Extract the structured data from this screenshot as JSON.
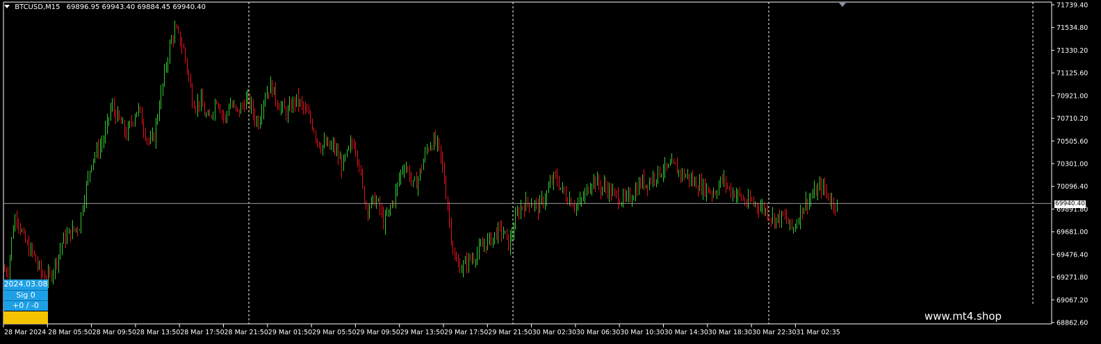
{
  "header": {
    "symbol": "BTCUSD,M15",
    "ohlc": "69896.95 69943.40 69884.45 69940.40"
  },
  "price_axis": {
    "labels": [
      "71739.40",
      "71534.80",
      "71330.20",
      "71125.60",
      "70921.00",
      "70710.20",
      "70505.60",
      "70301.00",
      "70096.40",
      "69891.80",
      "69681.00",
      "69476.40",
      "69271.80",
      "69067.20",
      "68862.60"
    ],
    "current_price": "69940.40"
  },
  "time_axis": {
    "labels": [
      "28 Mar 2024",
      "28 Mar 05:50",
      "28 Mar 09:50",
      "28 Mar 13:50",
      "28 Mar 17:50",
      "28 Mar 21:50",
      "29 Mar 01:50",
      "29 Mar 05:50",
      "29 Mar 09:50",
      "29 Mar 13:50",
      "29 Mar 17:50",
      "29 Mar 21:50",
      "30 Mar 02:30",
      "30 Mar 06:30",
      "30 Mar 10:30",
      "30 Mar 14:30",
      "30 Mar 18:30",
      "30 Mar 22:30",
      "31 Mar 02:35"
    ]
  },
  "panel": {
    "date": "2024.03.08",
    "signal": "Sig  0",
    "score": "+0 / -0"
  },
  "watermark": "www.mt4.shop",
  "colors": {
    "bull": "#32cd32",
    "bear": "#e8101e",
    "background": "#000000",
    "panel_blue": "#1ea0e6",
    "panel_yellow": "#f5c400"
  },
  "chart_data": {
    "type": "candlestick",
    "symbol": "BTCUSD",
    "timeframe": "M15",
    "ylim": [
      68862.6,
      71739.4
    ],
    "path": [
      [
        0,
        69480
      ],
      [
        3,
        69380
      ],
      [
        8,
        69330
      ],
      [
        14,
        69350
      ],
      [
        20,
        69700
      ],
      [
        25,
        69850
      ],
      [
        30,
        69750
      ],
      [
        36,
        69620
      ],
      [
        42,
        69540
      ],
      [
        50,
        69480
      ],
      [
        56,
        69380
      ],
      [
        62,
        69300
      ],
      [
        68,
        69260
      ],
      [
        74,
        69280
      ],
      [
        80,
        69380
      ],
      [
        86,
        69480
      ],
      [
        92,
        69600
      ],
      [
        100,
        69660
      ],
      [
        108,
        69700
      ],
      [
        116,
        69740
      ],
      [
        122,
        69980
      ],
      [
        128,
        70150
      ],
      [
        134,
        70350
      ],
      [
        142,
        70420
      ],
      [
        150,
        70510
      ],
      [
        156,
        70650
      ],
      [
        162,
        70830
      ],
      [
        168,
        70750
      ],
      [
        176,
        70660
      ],
      [
        184,
        70560
      ],
      [
        192,
        70700
      ],
      [
        200,
        70810
      ],
      [
        206,
        70690
      ],
      [
        212,
        70560
      ],
      [
        218,
        70480
      ],
      [
        224,
        70560
      ],
      [
        230,
        70820
      ],
      [
        236,
        71010
      ],
      [
        242,
        71240
      ],
      [
        248,
        71420
      ],
      [
        254,
        71510
      ],
      [
        260,
        71430
      ],
      [
        266,
        71330
      ],
      [
        272,
        71130
      ],
      [
        278,
        70900
      ],
      [
        284,
        70830
      ],
      [
        290,
        70880
      ],
      [
        296,
        70760
      ],
      [
        302,
        70680
      ],
      [
        308,
        70800
      ],
      [
        314,
        70900
      ],
      [
        320,
        70780
      ],
      [
        326,
        70700
      ],
      [
        332,
        70860
      ],
      [
        338,
        70800
      ],
      [
        344,
        70760
      ],
      [
        350,
        70820
      ],
      [
        356,
        70880
      ],
      [
        362,
        70840
      ],
      [
        368,
        70720
      ],
      [
        374,
        70680
      ],
      [
        380,
        70880
      ],
      [
        386,
        70960
      ],
      [
        392,
        71010
      ],
      [
        398,
        70900
      ],
      [
        404,
        70830
      ],
      [
        410,
        70780
      ],
      [
        416,
        70760
      ],
      [
        422,
        70840
      ],
      [
        428,
        70880
      ],
      [
        434,
        70840
      ],
      [
        440,
        70780
      ],
      [
        446,
        70720
      ],
      [
        452,
        70650
      ],
      [
        458,
        70520
      ],
      [
        464,
        70460
      ],
      [
        470,
        70480
      ],
      [
        476,
        70440
      ],
      [
        482,
        70460
      ],
      [
        488,
        70360
      ],
      [
        494,
        70280
      ],
      [
        500,
        70360
      ],
      [
        506,
        70460
      ],
      [
        512,
        70500
      ],
      [
        518,
        70320
      ],
      [
        524,
        70040
      ],
      [
        530,
        69900
      ],
      [
        536,
        69940
      ],
      [
        542,
        69980
      ],
      [
        548,
        69900
      ],
      [
        554,
        69760
      ],
      [
        560,
        69840
      ],
      [
        566,
        69940
      ],
      [
        572,
        70060
      ],
      [
        578,
        70220
      ],
      [
        584,
        70300
      ],
      [
        590,
        70220
      ],
      [
        596,
        70100
      ],
      [
        602,
        70140
      ],
      [
        608,
        70260
      ],
      [
        614,
        70400
      ],
      [
        620,
        70480
      ],
      [
        626,
        70500
      ],
      [
        632,
        70460
      ],
      [
        638,
        70280
      ],
      [
        644,
        70020
      ],
      [
        650,
        69700
      ],
      [
        656,
        69420
      ],
      [
        662,
        69380
      ],
      [
        668,
        69360
      ],
      [
        674,
        69420
      ],
      [
        680,
        69440
      ],
      [
        686,
        69480
      ],
      [
        692,
        69520
      ],
      [
        698,
        69560
      ],
      [
        704,
        69600
      ],
      [
        710,
        69620
      ],
      [
        716,
        69680
      ],
      [
        722,
        69700
      ],
      [
        728,
        69660
      ],
      [
        734,
        69560
      ],
      [
        740,
        69720
      ],
      [
        746,
        69840
      ],
      [
        752,
        69920
      ],
      [
        758,
        69940
      ],
      [
        764,
        69960
      ],
      [
        770,
        69940
      ],
      [
        776,
        69900
      ],
      [
        782,
        69960
      ],
      [
        788,
        70020
      ],
      [
        794,
        70120
      ],
      [
        800,
        70180
      ],
      [
        806,
        70120
      ],
      [
        812,
        70040
      ],
      [
        818,
        70000
      ],
      [
        824,
        69960
      ],
      [
        830,
        69920
      ],
      [
        836,
        69940
      ],
      [
        842,
        70000
      ],
      [
        848,
        70080
      ],
      [
        854,
        70160
      ],
      [
        860,
        70140
      ],
      [
        866,
        70080
      ],
      [
        872,
        70100
      ],
      [
        878,
        70060
      ],
      [
        884,
        70020
      ],
      [
        890,
        70000
      ],
      [
        896,
        69980
      ],
      [
        902,
        69960
      ],
      [
        908,
        70000
      ],
      [
        914,
        70040
      ],
      [
        920,
        70100
      ],
      [
        926,
        70140
      ],
      [
        932,
        70120
      ],
      [
        938,
        70160
      ],
      [
        944,
        70200
      ],
      [
        950,
        70220
      ],
      [
        956,
        70260
      ],
      [
        962,
        70240
      ],
      [
        968,
        70280
      ],
      [
        974,
        70260
      ],
      [
        980,
        70220
      ],
      [
        986,
        70200
      ],
      [
        992,
        70180
      ],
      [
        998,
        70140
      ],
      [
        1004,
        70120
      ],
      [
        1010,
        70100
      ],
      [
        1016,
        70080
      ],
      [
        1022,
        70060
      ],
      [
        1028,
        70040
      ],
      [
        1034,
        70080
      ],
      [
        1040,
        70160
      ],
      [
        1046,
        70120
      ],
      [
        1052,
        70060
      ],
      [
        1058,
        70040
      ],
      [
        1064,
        70020
      ],
      [
        1070,
        69980
      ],
      [
        1076,
        69940
      ],
      [
        1082,
        69960
      ],
      [
        1088,
        69940
      ],
      [
        1094,
        69920
      ],
      [
        1100,
        69900
      ],
      [
        1106,
        69860
      ],
      [
        1112,
        69820
      ],
      [
        1118,
        69800
      ],
      [
        1124,
        69810
      ],
      [
        1130,
        69820
      ],
      [
        1136,
        69760
      ],
      [
        1142,
        69700
      ],
      [
        1148,
        69780
      ],
      [
        1154,
        69880
      ],
      [
        1160,
        69940
      ],
      [
        1166,
        69980
      ],
      [
        1172,
        70020
      ],
      [
        1178,
        70060
      ],
      [
        1184,
        70100
      ],
      [
        1190,
        70040
      ],
      [
        1196,
        69980
      ],
      [
        1202,
        69940
      ],
      [
        1205,
        69940
      ]
    ]
  }
}
